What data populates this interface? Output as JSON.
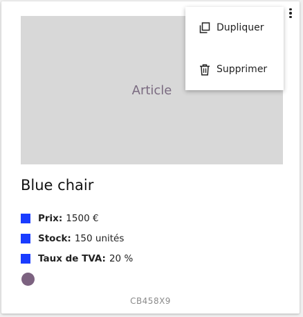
{
  "card": {
    "image_placeholder": "Article",
    "title": "Blue chair",
    "attributes": [
      {
        "label": "Prix:",
        "value": "1500 €"
      },
      {
        "label": "Stock:",
        "value": "150 unités"
      },
      {
        "label": "Taux de TVA:",
        "value": "20 %"
      }
    ],
    "color_swatch": "#7c6280",
    "bullet_color": "#1a3cff",
    "sku": "CB458X9"
  },
  "menu": {
    "items": [
      {
        "label": "Dupliquer",
        "icon": "copy-icon"
      },
      {
        "label": "Supprimer",
        "icon": "trash-icon"
      }
    ]
  },
  "more_icon": "more-vertical-icon"
}
